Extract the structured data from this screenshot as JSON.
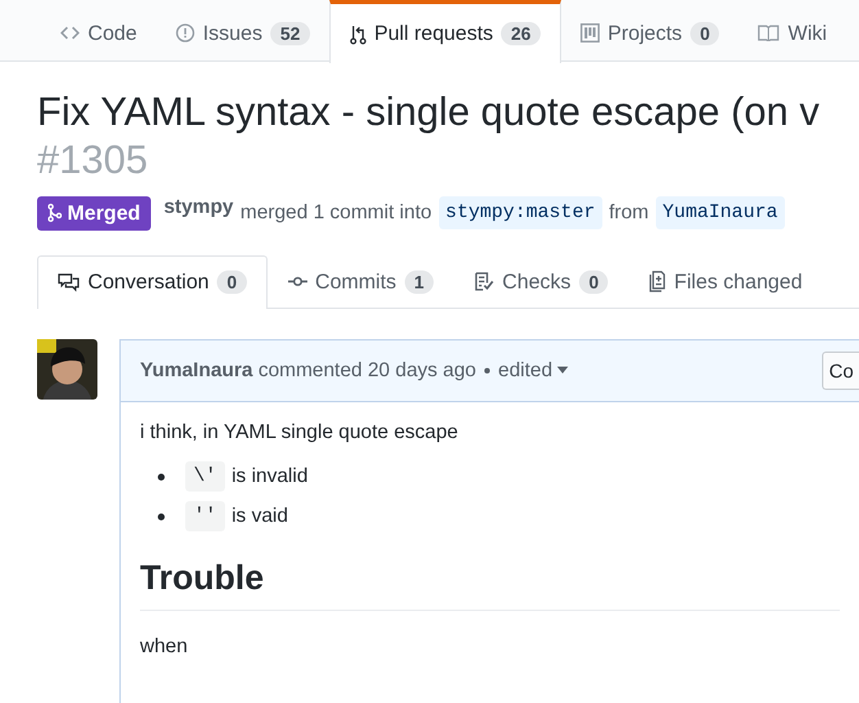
{
  "repo_tabs": [
    {
      "kind": "code",
      "label": "Code",
      "selected": false
    },
    {
      "kind": "issue",
      "label": "Issues",
      "count": "52",
      "selected": false
    },
    {
      "kind": "pr",
      "label": "Pull requests",
      "count": "26",
      "selected": true
    },
    {
      "kind": "project",
      "label": "Projects",
      "count": "0",
      "selected": false
    },
    {
      "kind": "wiki",
      "label": "Wiki",
      "selected": false
    }
  ],
  "title": "Fix YAML syntax - single quote escape (on v",
  "number": "#1305",
  "state": {
    "label": "Merged",
    "kind": "merged"
  },
  "merge_info": {
    "author": "stympy",
    "text": "merged 1 commit into",
    "base": "stympy:master",
    "from": "from",
    "head": "YumaInaura"
  },
  "pr_tabs": [
    {
      "kind": "conversation",
      "label": "Conversation",
      "count": "0",
      "selected": true
    },
    {
      "kind": "commits",
      "label": "Commits",
      "count": "1",
      "selected": false
    },
    {
      "kind": "checks",
      "label": "Checks",
      "count": "0",
      "selected": false
    },
    {
      "kind": "files",
      "label": "Files changed",
      "selected": false
    }
  ],
  "comment": {
    "author": "YumaInaura",
    "meta": "commented 20 days ago",
    "edited": "edited",
    "button": "Co",
    "intro": "i think, in YAML single quote escape",
    "bullets": [
      {
        "code": "\\'",
        "text": "is invalid"
      },
      {
        "code": "''",
        "text": "is vaid"
      }
    ],
    "heading": "Trouble",
    "after": "when"
  }
}
